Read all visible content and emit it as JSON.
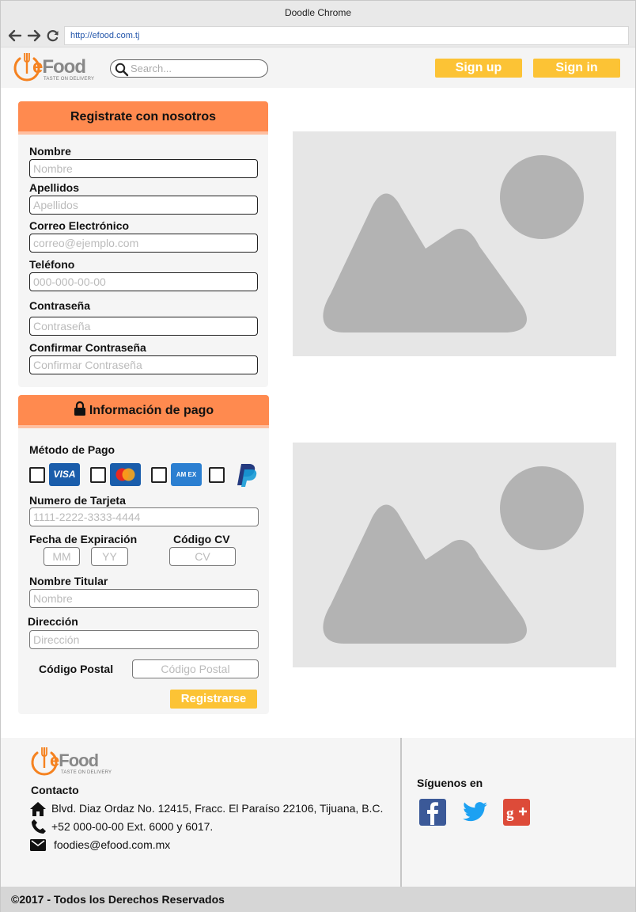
{
  "browser": {
    "title": "Doodle Chrome",
    "url": "http://efood.com.tj"
  },
  "header": {
    "logo_text_e": "e",
    "logo_text_rest": "Food",
    "logo_tagline": "TASTE ON DELIVERY",
    "search_placeholder": "Search...",
    "signup_label": "Sign up",
    "signin_label": "Sign in"
  },
  "register": {
    "title": "Registrate con nosotros",
    "fields": [
      {
        "label": "Nombre",
        "placeholder": "Nombre"
      },
      {
        "label": "Apellidos",
        "placeholder": "Apellidos"
      },
      {
        "label": "Correo Electrónico",
        "placeholder": "correo@ejemplo.com"
      },
      {
        "label": "Teléfono",
        "placeholder": "000-000-00-00"
      },
      {
        "label": "Contraseña",
        "placeholder": "Contraseña"
      },
      {
        "label": "Confirmar Contraseña",
        "placeholder": "Confirmar Contraseña"
      }
    ]
  },
  "payment": {
    "title": "Información de pago",
    "method_label": "Método de Pago",
    "cards": [
      {
        "name": "visa",
        "text": "VISA"
      },
      {
        "name": "mastercard",
        "text": ""
      },
      {
        "name": "amex",
        "text": "AM EX"
      },
      {
        "name": "paypal",
        "text": ""
      }
    ],
    "card_number_label": "Numero de Tarjeta",
    "card_number_placeholder": "1111-2222-3333-4444",
    "expiration_label": "Fecha de Expiración",
    "month_placeholder": "MM",
    "year_placeholder": "YY",
    "cv_label": "Código CV",
    "cv_placeholder": "CV",
    "holder_label": "Nombre Titular",
    "holder_placeholder": "Nombre",
    "address_label": "Dirección",
    "address_placeholder": "Dirección",
    "postal_label": "Código Postal",
    "postal_placeholder": "Código Postal",
    "submit_label": "Registrarse"
  },
  "footer": {
    "contact_title": "Contacto",
    "address": "Blvd. Diaz Ordaz No. 12415, Fracc. El Paraíso 22106, Tijuana, B.C.",
    "phone": "+52 000-00-00 Ext. 6000 y 6017.",
    "email": "foodies@efood.com.mx",
    "follow_title": "Síguenos en",
    "copyright": "©2017 - Todos los Derechos Reservados"
  },
  "colors": {
    "accent_orange": "#ff8a4f",
    "button_yellow": "#fcc335",
    "logo_orange": "#f58220"
  }
}
